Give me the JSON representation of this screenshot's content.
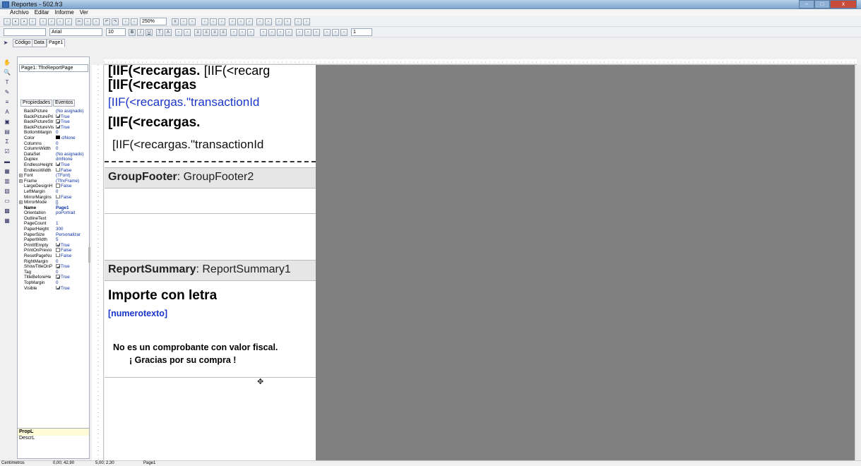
{
  "window": {
    "title": "Reportes - 502.fr3",
    "close_glyph": "x"
  },
  "menu": [
    "Archivo",
    "Editar",
    "Informe",
    "Ver"
  ],
  "toolbar": {
    "zoom": "250%",
    "font_name": "Arial",
    "font_size": "10",
    "line_width": "1"
  },
  "tabs": [
    "Código",
    "Data",
    "Page1"
  ],
  "inspector": {
    "object_selector": "Page1: TfrxReportPage",
    "tabs": [
      "Propiedades",
      "Eventos"
    ],
    "properties": [
      {
        "name": "BackPicture",
        "value": "(No asignado)"
      },
      {
        "name": "BackPicturePri",
        "value": "True",
        "check": true
      },
      {
        "name": "BackPictureStr",
        "value": "True",
        "check": true
      },
      {
        "name": "BackPictureVis",
        "value": "True",
        "check": true
      },
      {
        "name": "BottomMargin",
        "value": "0"
      },
      {
        "name": "Color",
        "value": "clNone",
        "swatch": true
      },
      {
        "name": "Columns",
        "value": "0"
      },
      {
        "name": "ColumnWidth",
        "value": "0"
      },
      {
        "name": "DataSet",
        "value": "(No asignado)"
      },
      {
        "name": "Duplex",
        "value": "dmNone"
      },
      {
        "name": "EndlessHeight",
        "value": "True",
        "check": true
      },
      {
        "name": "EndlessWidth",
        "value": "False",
        "check": true
      },
      {
        "name": "Font",
        "value": "(TFont)",
        "expand": true
      },
      {
        "name": "Frame",
        "value": "(TfrxFrame)",
        "expand": true
      },
      {
        "name": "LargeDesignH",
        "value": "False",
        "check": true
      },
      {
        "name": "LeftMargin",
        "value": "0"
      },
      {
        "name": "MirrorMargins",
        "value": "False",
        "check": true
      },
      {
        "name": "MirrorMode",
        "value": "[]",
        "expand": true
      },
      {
        "name": "Name",
        "value": "Page1",
        "bold": true
      },
      {
        "name": "Orientation",
        "value": "poPortrait"
      },
      {
        "name": "OutlineText",
        "value": ""
      },
      {
        "name": "PageCount",
        "value": "1"
      },
      {
        "name": "PaperHeight",
        "value": "300"
      },
      {
        "name": "PaperSize",
        "value": "Personalizar"
      },
      {
        "name": "PaperWidth",
        "value": "5"
      },
      {
        "name": "PrintIfEmpty",
        "value": "True",
        "check": true
      },
      {
        "name": "PrintOnPrevio",
        "value": "False",
        "check": true
      },
      {
        "name": "ResetPageNu",
        "value": "False",
        "check": true
      },
      {
        "name": "RightMargin",
        "value": "0"
      },
      {
        "name": "ShowTitleOnP",
        "value": "True",
        "check": true
      },
      {
        "name": "Tag",
        "value": "0"
      },
      {
        "name": "TitleBeforeHe",
        "value": "True",
        "check": true
      },
      {
        "name": "TopMargin",
        "value": "0"
      },
      {
        "name": "Visible",
        "value": "True",
        "check": true
      }
    ],
    "desc_title": "PropL",
    "desc_text": "DescrL"
  },
  "report": {
    "memo1": "[IIF(<recargas.",
    "memo1b": "[IIF(<recarg",
    "memo2": "[IIF(<recargas",
    "memo3": "[IIF(<recargas.\"transactionId",
    "memo4": "[IIF(<recargas.",
    "memo5": "[IIF(<recargas.\"transactionId",
    "group_footer_type": "GroupFooter",
    "group_footer_name": ": GroupFooter2",
    "summary_type": "ReportSummary",
    "summary_name": ": ReportSummary1",
    "importe": "Importe con letra",
    "numerotexto": "[numerotexto]",
    "fiscal_line1": "No es un comprobante con valor fiscal.",
    "fiscal_line2": "¡ Gracias por su compra !"
  },
  "status": {
    "units": "Centímetros",
    "pos1": "0,00; 42,90",
    "pos2": "5,00; 2,30",
    "page": "Page1"
  }
}
